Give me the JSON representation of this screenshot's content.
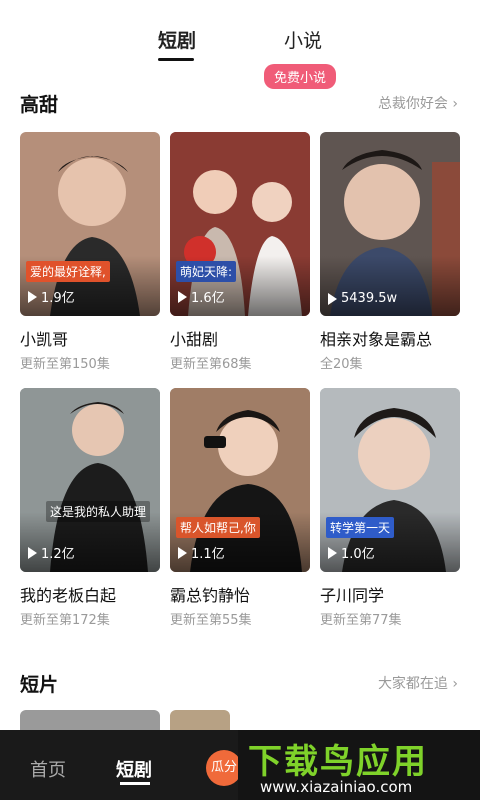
{
  "top_tabs": {
    "drama": "短剧",
    "novel": "小说",
    "novel_badge": "免费小说"
  },
  "section_sweet": {
    "title": "高甜",
    "more": "总裁你好会"
  },
  "section_short": {
    "title": "短片",
    "more": "大家都在追"
  },
  "cards": [
    {
      "title": "小凯哥",
      "sub": "更新至第150集",
      "plays": "1.9亿",
      "caption": "爱的最好诠释,",
      "caption_color": "#e0522b",
      "bg": "#b58f7a"
    },
    {
      "title": "小甜剧",
      "sub": "更新至第68集",
      "plays": "1.6亿",
      "caption": "萌妃天降:",
      "caption_color": "#2d4fa8",
      "bg": "#a0433a"
    },
    {
      "title": "相亲对象是霸总",
      "sub": "全20集",
      "plays": "5439.5w",
      "caption": "",
      "caption_color": "#000000",
      "bg": "#5f5551"
    },
    {
      "title": "我的老板白起",
      "sub": "更新至第172集",
      "plays": "1.2亿",
      "caption": "这是我的私人助理",
      "caption_color": "#333333",
      "bg": "#6b6e6e"
    },
    {
      "title": "霸总钓静怡",
      "sub": "更新至第55集",
      "plays": "1.1亿",
      "caption": "帮人如帮己,你",
      "caption_color": "#d9552b",
      "bg": "#8d6e5c"
    },
    {
      "title": "子川同学",
      "sub": "更新至第77集",
      "plays": "1.0亿",
      "caption": "转学第一天",
      "caption_color": "#2f5cc9",
      "bg": "#9aa0a5"
    }
  ],
  "bottom_nav": {
    "home": "首页",
    "drama": "短剧",
    "gua": "瓜分"
  },
  "watermark": {
    "big": "下载鸟应用",
    "small": "www.xiazainiao.com"
  },
  "colors": {
    "badge": "#f05c78",
    "watermark_green": "#7fd22a",
    "nav_bg": "#1a1a1a"
  }
}
